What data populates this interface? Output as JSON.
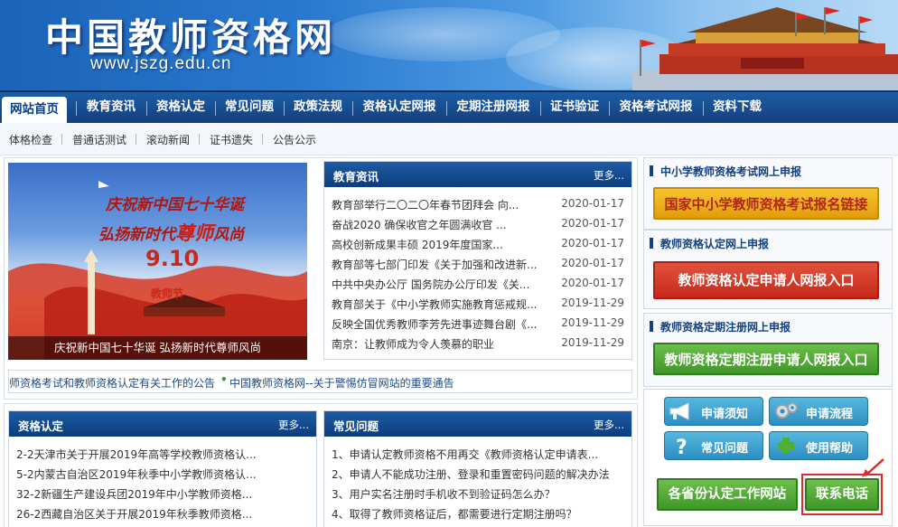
{
  "header": {
    "site_title": "中国教师资格网",
    "site_url": "www.jszg.edu.cn"
  },
  "nav": {
    "items": [
      "网站首页",
      "教育资讯",
      "资格认定",
      "常见问题",
      "政策法规",
      "资格认定网报",
      "定期注册网报",
      "证书验证",
      "资格考试网报",
      "资料下载"
    ],
    "active_index": 0
  },
  "subnav": {
    "items": [
      "体格检查",
      "普通话测试",
      "滚动新闻",
      "证书遗失",
      "公告公示"
    ]
  },
  "photo": {
    "caption": "庆祝新中国七十华诞 弘扬新时代尊师风尚",
    "headline1": "庆祝新中国七十华诞",
    "headline2a": "弘扬新时代",
    "headline2b": "尊师",
    "headline2c": "风尚",
    "date": "9.10",
    "tag": "教师节"
  },
  "news": {
    "title": "教育资讯",
    "more": "更多...",
    "items": [
      {
        "text": "教育部举行二〇二〇年春节团拜会 向...",
        "date": "2020-01-17"
      },
      {
        "text": "奋战2020 确保收官之年圆满收官 ...",
        "date": "2020-01-17"
      },
      {
        "text": "高校创新成果丰硕 2019年度国家...",
        "date": "2020-01-17"
      },
      {
        "text": "教育部等七部门印发《关于加强和改进新...",
        "date": "2020-01-17"
      },
      {
        "text": "中共中央办公厅 国务院办公厅印发《关...",
        "date": "2020-01-17"
      },
      {
        "text": "教育部关于《中小学教师实施教育惩戒规...",
        "date": "2019-11-29"
      },
      {
        "text": "反映全国优秀教师李芳先进事迹舞台剧《...",
        "date": "2019-11-29"
      },
      {
        "text": "南京：让教师成为令人羡慕的职业",
        "date": "2019-11-29"
      }
    ]
  },
  "ticker": {
    "item1": "师资格考试和教师资格认定有关工作的公告",
    "item2": "中国教师资格网--关于警惕仿冒网站的重要通告"
  },
  "qualification": {
    "title": "资格认定",
    "more": "更多...",
    "items": [
      "2-2天津市关于开展2019年高等学校教师资格认...",
      "5-2内蒙古自治区2019年秋季中小学教师资格认...",
      "32-2新疆生产建设兵团2019年中小学教师资格...",
      "26-2西藏自治区关于开展2019年秋季教师资格..."
    ]
  },
  "faq": {
    "title": "常见问题",
    "more": "更多...",
    "items": [
      "1、申请认定教师资格不用再交《教师资格认定申请表...",
      "2、申请人不能成功注册、登录和重置密码问题的解决办法",
      "3、用户实名注册时手机收不到验证码怎么办？",
      "4、取得了教师资格证后，都需要进行定期注册吗？"
    ]
  },
  "sidebar": {
    "exam": {
      "heading": "中小学教师资格考试网上申报",
      "button": "国家中小学教师资格考试报名链接"
    },
    "cert": {
      "heading": "教师资格认定网上申报",
      "button": "教师资格认定申请人网报入口"
    },
    "reg": {
      "heading": "教师资格定期注册网上申报",
      "button": "教师资格定期注册申请人网报入口"
    },
    "quick": [
      "申请须知",
      "申请流程",
      "常见问题",
      "使用帮助"
    ],
    "province_button": "各省份认定工作网站",
    "contact_button": "联系电话"
  },
  "colors": {
    "nav_blue": "#123f7d",
    "panel_head_blue": "#0d3d7d",
    "highlight_red": "#e02b2b"
  }
}
